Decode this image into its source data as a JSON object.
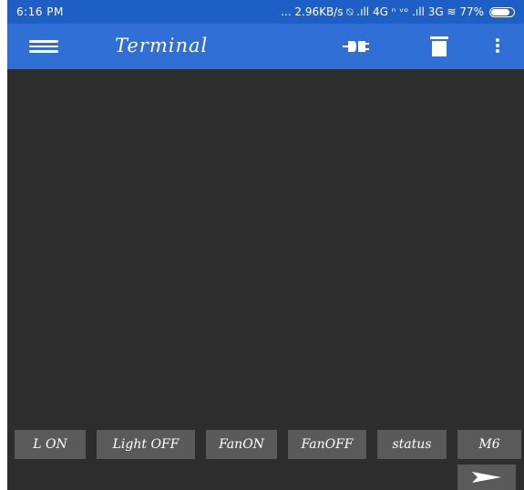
{
  "statusbar": {
    "time": "6:16 PM",
    "indicators": "... 2.96KB/s ⍉ .ıll 4G ⁿ ᵛᵒ .ıll 3G ≋ 77%",
    "battery_percent": 77
  },
  "appbar": {
    "title": "Terminal",
    "icons": [
      "menu-icon",
      "connect-icon",
      "delete-icon",
      "more-vert-icon"
    ]
  },
  "colors": {
    "statusbar": "#1e5fc5",
    "appbar": "#2f6fd6",
    "background": "#2d2d2d",
    "button": "#5a5a5a"
  },
  "macros": [
    "L ON",
    "Light OFF",
    "FanON",
    "FanOFF",
    "status",
    "M6"
  ],
  "send": {
    "icon": "send-icon"
  }
}
